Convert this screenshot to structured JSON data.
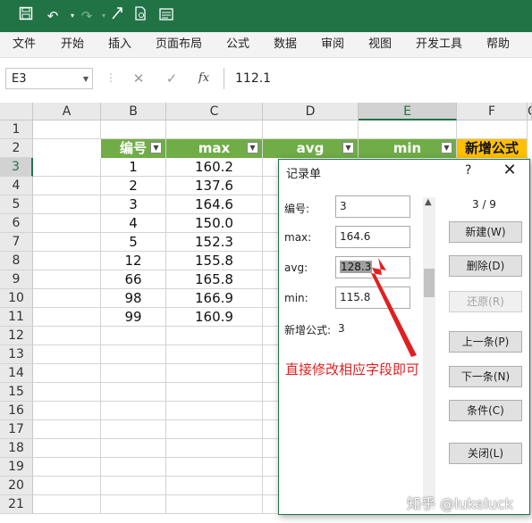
{
  "quick_access": {
    "icons": [
      "save-icon",
      "undo-icon",
      "redo-icon",
      "format-painter-icon",
      "document-icon",
      "form-icon"
    ]
  },
  "ribbon_tabs": [
    "文件",
    "开始",
    "插入",
    "页面布局",
    "公式",
    "数据",
    "审阅",
    "视图",
    "开发工具",
    "帮助"
  ],
  "formula_bar": {
    "name_box": "E3",
    "cancel_icon": "✕",
    "enter_icon": "✓",
    "fx_icon": "fx",
    "value": "112.1"
  },
  "columns": [
    "A",
    "B",
    "C",
    "D",
    "E",
    "F",
    "C"
  ],
  "rows": [
    "1",
    "2",
    "3",
    "4",
    "5",
    "6",
    "7",
    "8",
    "9",
    "10",
    "11",
    "12",
    "13",
    "14",
    "15",
    "16",
    "17",
    "18",
    "19",
    "20",
    "21"
  ],
  "header_row": {
    "b": "编号",
    "c": "max",
    "d": "avg",
    "e": "min",
    "f": "新增公式"
  },
  "table": [
    {
      "b": "1",
      "c": "160.2"
    },
    {
      "b": "2",
      "c": "137.6"
    },
    {
      "b": "3",
      "c": "164.6"
    },
    {
      "b": "4",
      "c": "150.0"
    },
    {
      "b": "5",
      "c": "152.3"
    },
    {
      "b": "12",
      "c": "155.8"
    },
    {
      "b": "66",
      "c": "165.8"
    },
    {
      "b": "98",
      "c": "166.9"
    },
    {
      "b": "99",
      "c": "160.9"
    }
  ],
  "dialog": {
    "title": "记录单",
    "help": "?",
    "close": "✕",
    "record_counter": "3 / 9",
    "fields": [
      {
        "label": "编号:",
        "value": "3"
      },
      {
        "label": "max:",
        "value": "164.6"
      },
      {
        "label": "avg:",
        "value": "128.3"
      },
      {
        "label": "min:",
        "value": "115.8"
      }
    ],
    "computed_field": {
      "label": "新增公式:",
      "value": "3"
    },
    "buttons": {
      "new": "新建(W)",
      "delete": "删除(D)",
      "restore": "还原(R)",
      "prev": "上一条(P)",
      "next": "下一条(N)",
      "criteria": "条件(C)",
      "close": "关闭(L)"
    }
  },
  "annotation": "直接修改相应字段即可",
  "watermark": "知乎 @lukeluck",
  "colors": {
    "title_bar": "#217346",
    "table_header_green": "#70ad47",
    "table_header_orange": "#ffc000",
    "annotation_red": "#e02020"
  }
}
